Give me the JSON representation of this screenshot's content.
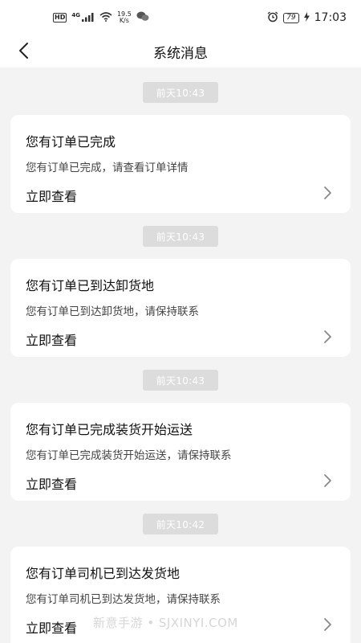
{
  "status_bar": {
    "hd": "HD",
    "network": "4G",
    "speed_value": "19.5",
    "speed_unit": "K/s",
    "battery": "79",
    "time": "17:03",
    "icons": [
      "signal-icon",
      "wifi-icon",
      "wechat-icon",
      "alarm-icon",
      "charging-icon"
    ]
  },
  "header": {
    "title": "系统消息",
    "back_icon": "chevron-left-icon"
  },
  "messages": [
    {
      "time": "前天10:43",
      "title": "您有订单已完成",
      "desc": "您有订单已完成，请查看订单详情",
      "action": "立即查看"
    },
    {
      "time": "前天10:43",
      "title": "您有订单已到达卸货地",
      "desc": "您有订单已到达卸货地，请保持联系",
      "action": "立即查看"
    },
    {
      "time": "前天10:43",
      "title": "您有订单已完成装货开始运送",
      "desc": "您有订单已完成装货开始运送，请保持联系",
      "action": "立即查看"
    },
    {
      "time": "前天10:42",
      "title": "您有订单司机已到达发货地",
      "desc": "您有订单司机已到达发货地，请保持联系",
      "action": "立即查看"
    }
  ],
  "watermark": "新意手游 • SJXINYI.COM"
}
